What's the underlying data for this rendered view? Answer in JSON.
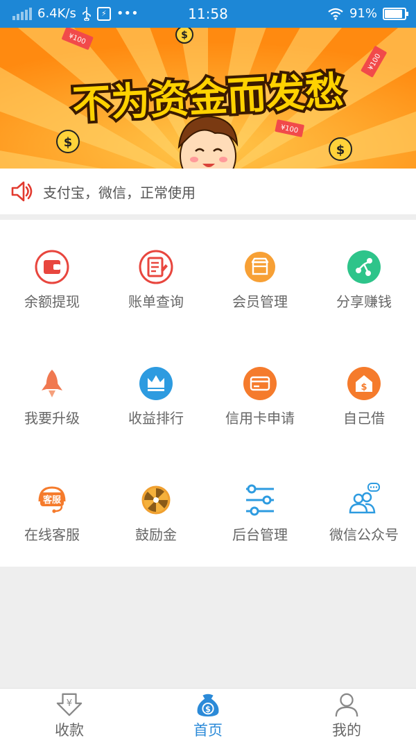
{
  "status_bar": {
    "speed": "6.4K/s",
    "usb_badge": "⚡",
    "more": "•••",
    "time": "11:58",
    "battery_percent": "91%",
    "battery_level": 0.91
  },
  "banner": {
    "headline": "不为资金而发愁",
    "money_note": "¥100",
    "coin_symbol": "$"
  },
  "notice": {
    "text": "支付宝，微信，正常使用"
  },
  "grid": {
    "items": [
      {
        "label": "余额提现",
        "icon": "wallet-icon",
        "color": "#e8463e"
      },
      {
        "label": "账单查询",
        "icon": "bill-icon",
        "color": "#e8463e"
      },
      {
        "label": "会员管理",
        "icon": "shop-icon",
        "color": "#f7a035"
      },
      {
        "label": "分享赚钱",
        "icon": "share-icon",
        "color": "#2ec48a"
      },
      {
        "label": "我要升级",
        "icon": "rocket-icon",
        "color": "#f07850"
      },
      {
        "label": "收益排行",
        "icon": "crown-icon",
        "color": "#2d9be0"
      },
      {
        "label": "信用卡申请",
        "icon": "credit-card-icon",
        "color": "#f57b2c"
      },
      {
        "label": "自己借",
        "icon": "loan-icon",
        "color": "#f57b2c"
      },
      {
        "label": "在线客服",
        "icon": "customer-service-icon",
        "color": "#f57b2c"
      },
      {
        "label": "鼓励金",
        "icon": "wheel-icon",
        "color": "#f0a030"
      },
      {
        "label": "后台管理",
        "icon": "sliders-icon",
        "color": "#2d9be0"
      },
      {
        "label": "微信公众号",
        "icon": "wechat-group-icon",
        "color": "#2d9be0"
      }
    ],
    "service_badge": "客服"
  },
  "bottom_nav": {
    "tabs": [
      {
        "label": "收款",
        "icon": "receive-money-icon",
        "active": false
      },
      {
        "label": "首页",
        "icon": "home-moneybag-icon",
        "active": true
      },
      {
        "label": "我的",
        "icon": "profile-icon",
        "active": false
      }
    ],
    "active_color": "#2b8ad8",
    "inactive_color": "#666666"
  }
}
